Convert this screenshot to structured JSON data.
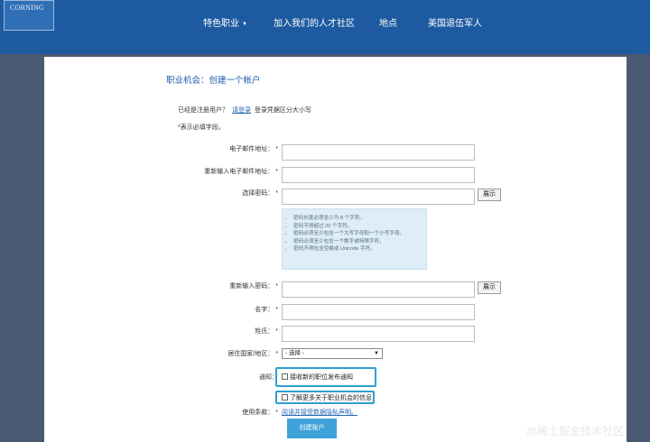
{
  "header": {
    "logo_text": "CORNING",
    "nav": [
      {
        "label": "特色职业"
      },
      {
        "label": "加入我们的人才社区"
      },
      {
        "label": "地点"
      },
      {
        "label": "美国退伍军人"
      }
    ]
  },
  "page": {
    "title": "职业机会：创建一个帐户",
    "registered_prefix": "已经是注册用户？",
    "login_link": "请登录",
    "registered_suffix": "登录凭据区分大小写",
    "required_note": "*表示必填字段。"
  },
  "form": {
    "email_label": "电子邮件地址：",
    "email_confirm_label": "重新输入电子邮件地址：",
    "password_label": "选择密码：",
    "password_confirm_label": "重新输入密码：",
    "first_name_label": "名字：",
    "last_name_label": "姓氏：",
    "country_label": "居住国家/地区：",
    "notify_label": "通知：",
    "terms_label": "使用条款：",
    "required_mark": "*",
    "show_button": "展示",
    "country_selected": "- 选择 -",
    "notify_option_1": "接收新的职位发布通知",
    "notify_option_2": "了解更多关于职业机会的信息",
    "privacy_link": "阅读并接受数据隐私声明。",
    "create_button": "创建账户",
    "password_rules": [
      "密码长度必须至少为 8 个字符。",
      "密码不得超过 20 个字符。",
      "密码必须至少包含一个大写字母和一个小写字母。",
      "密码必须至少包含一个数字或特殊字符。",
      "密码不得包含空格或 Unicode 字符。"
    ]
  },
  "watermark": "@稀土掘金技术社区"
}
